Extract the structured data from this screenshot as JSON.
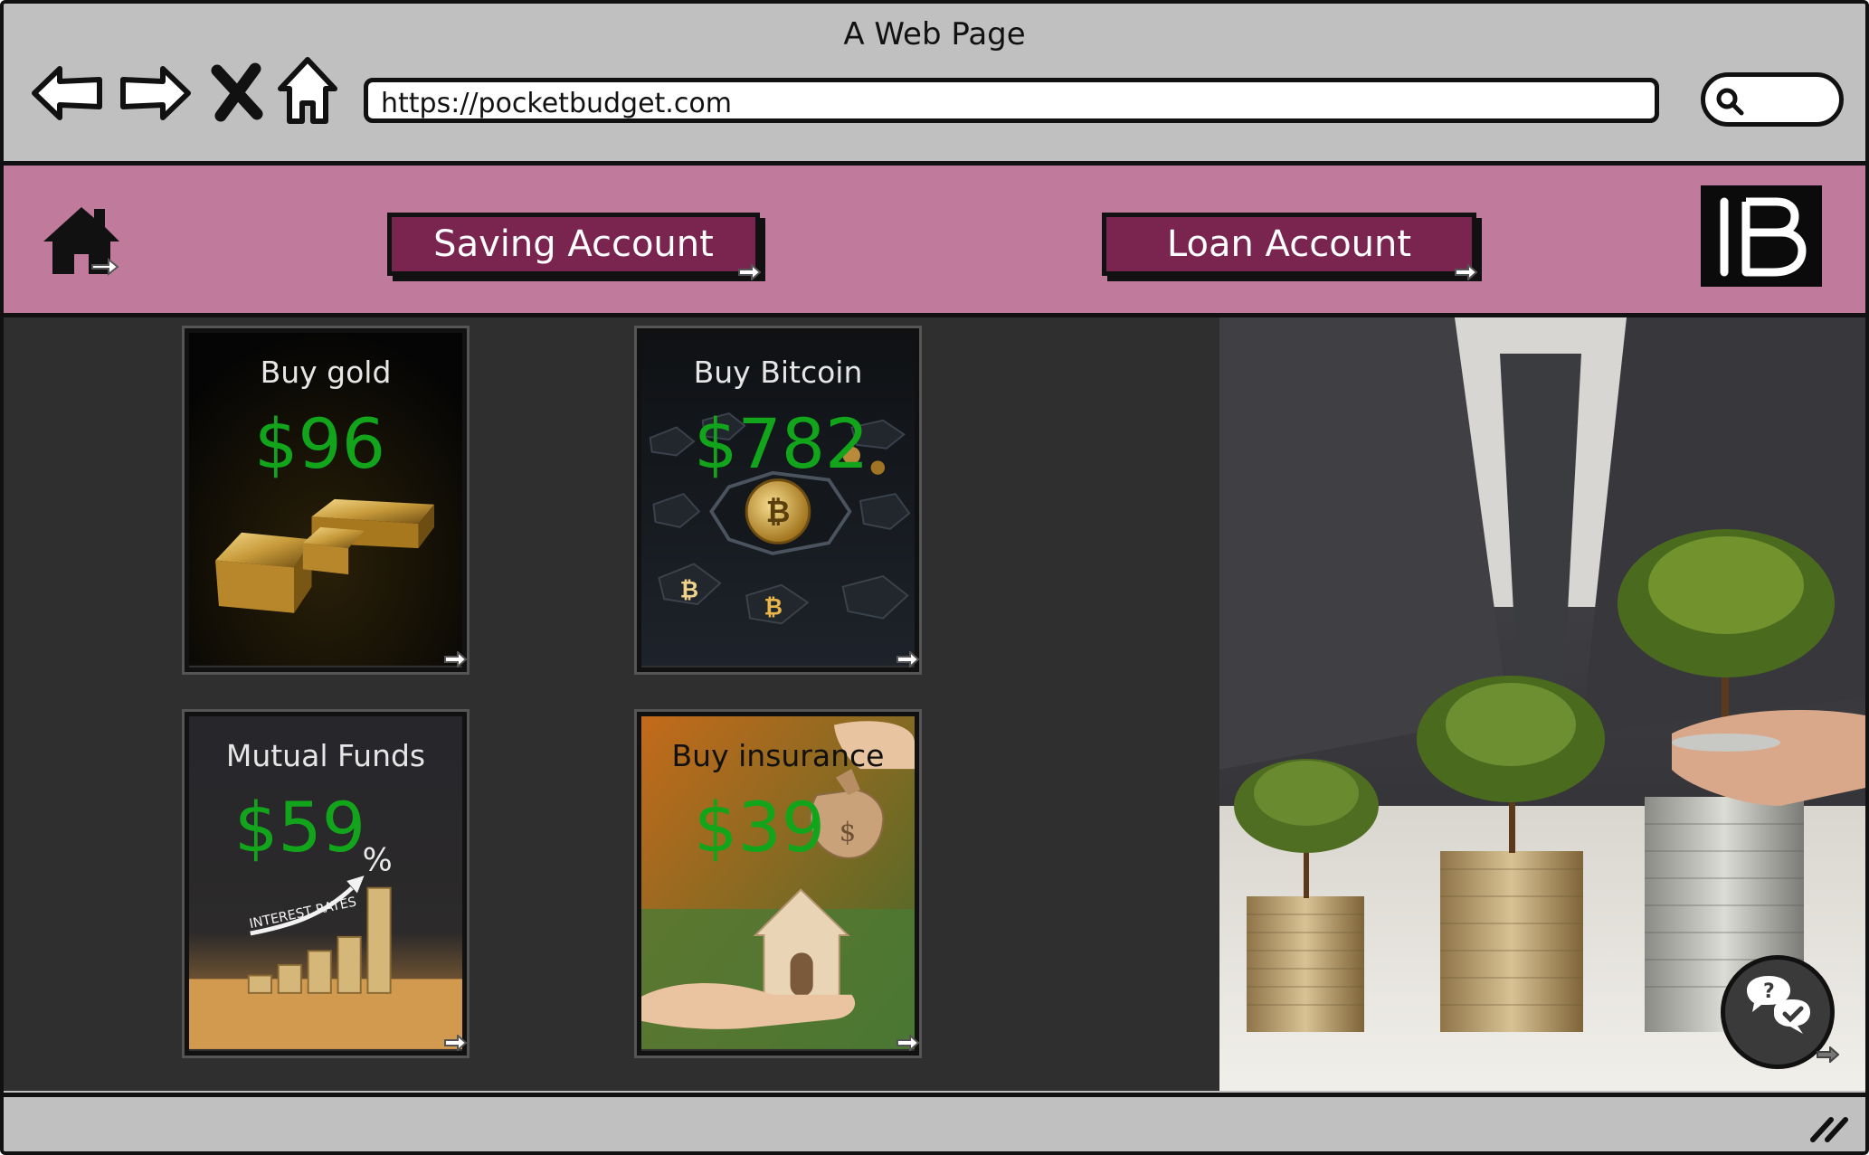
{
  "window": {
    "title": "A Web Page"
  },
  "browser": {
    "url": "https://pocketbudget.com",
    "icons": [
      "back-arrow-icon",
      "forward-arrow-icon",
      "close-x-icon",
      "home-icon",
      "search-icon"
    ]
  },
  "header": {
    "background": "#c07a9c",
    "accent": "#7a2450",
    "nav": [
      {
        "label": "Saving Account"
      },
      {
        "label": "Loan Account"
      }
    ],
    "logo": "PB"
  },
  "cards": [
    {
      "title": "Buy gold",
      "price": "$96"
    },
    {
      "title": "Buy Bitcoin",
      "price": "$782"
    },
    {
      "title": "Mutual Funds",
      "price": "$59"
    },
    {
      "title": "Buy insurance",
      "price": "$39"
    }
  ],
  "card_art_text": {
    "mutual_funds_chart": "INTEREST RATES",
    "percent": "%"
  },
  "hero": {
    "image": "money-tree-coin-stacks"
  },
  "chat": {
    "icon": "chat-bubbles-icon"
  }
}
